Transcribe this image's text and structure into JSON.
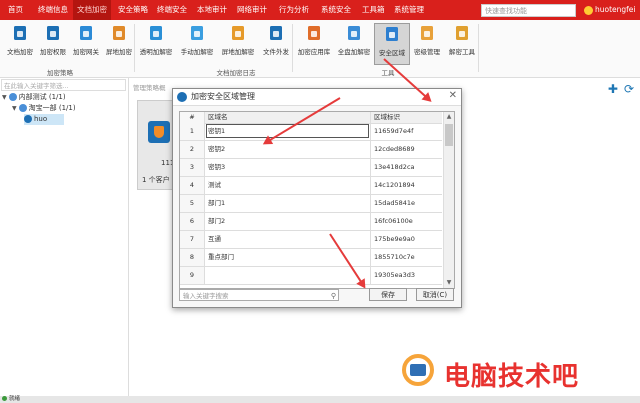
{
  "menubar": {
    "items": [
      "首页",
      "终端信息",
      "文档加密",
      "安全策略",
      "终端安全",
      "本地审计",
      "网络审计",
      "行为分析",
      "系统安全",
      "工具箱",
      "系统管理"
    ],
    "active_index": 2,
    "search_placeholder": "快速查找功能",
    "user": "huotengfei"
  },
  "ribbon": {
    "buttons": [
      "文档加密",
      "加密权限",
      "加密网关",
      "屏地加密",
      "透明加解密",
      "手动加解密",
      "屏地加解密",
      "文件外发",
      "加密应用库",
      "全盘加解密",
      "安全区域",
      "密级管理",
      "解密工具"
    ],
    "groups": [
      "加密策略",
      "文档加密日志",
      "工具"
    ],
    "selected_index": 10
  },
  "left": {
    "filter_placeholder": "在此输入关键字筛选...",
    "tree": [
      {
        "label": "内部测试 (1/1)",
        "level": 0
      },
      {
        "label": "淘宝一部 (1/1)",
        "level": 1
      },
      {
        "label": "huo",
        "level": 2
      }
    ]
  },
  "main": {
    "title": "管理策略概",
    "card_number": "111",
    "card_desc": "1 个客户"
  },
  "dialog": {
    "title": "加密安全区域管理",
    "col_index": "#",
    "col_name": "区域名",
    "col_id": "区域标识",
    "rows": [
      {
        "n": "1",
        "name": "密钥1",
        "id": "11659d7e4f"
      },
      {
        "n": "2",
        "name": "密钥2",
        "id": "12cded8689"
      },
      {
        "n": "3",
        "name": "密钥3",
        "id": "13e418d2ca"
      },
      {
        "n": "4",
        "name": "测试",
        "id": "14c1201894"
      },
      {
        "n": "5",
        "name": "部门1",
        "id": "15dad5841e"
      },
      {
        "n": "6",
        "name": "部门2",
        "id": "16fc06100e"
      },
      {
        "n": "7",
        "name": "互通",
        "id": "175be9e9a0"
      },
      {
        "n": "8",
        "name": "重点部门",
        "id": "1855710c7e"
      },
      {
        "n": "9",
        "name": "",
        "id": "19305ea3d3"
      }
    ],
    "search_placeholder": "输入关键字搜索",
    "save_label": "保存",
    "cancel_label": "取消(C)"
  },
  "statusbar": {
    "text": "就绪"
  },
  "watermark": {
    "text": "电脑技术吧"
  },
  "colors": {
    "menubar": "#d9201c",
    "arrow": "#e53b3b",
    "accent": "#1d6fb4"
  }
}
